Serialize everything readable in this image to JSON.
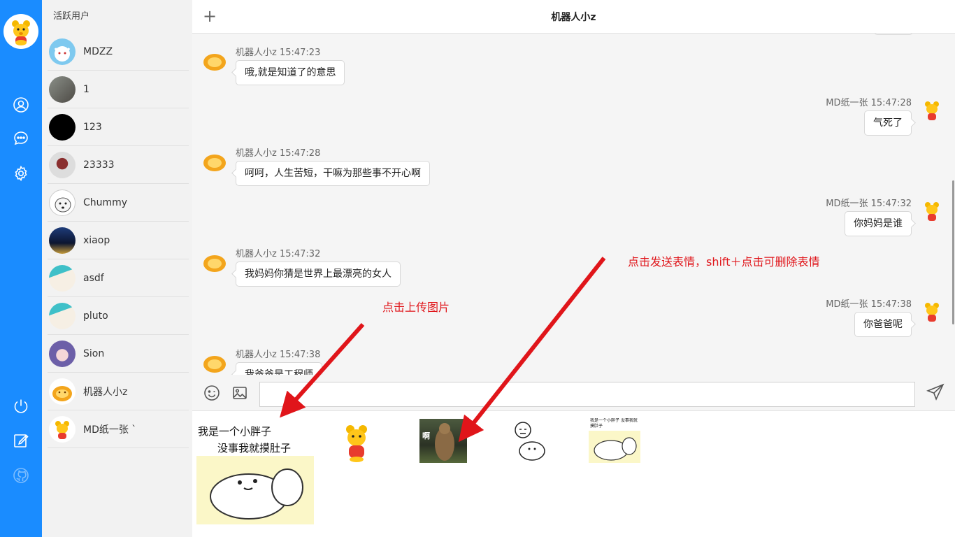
{
  "sidebar": {
    "title": "活跃用户"
  },
  "users": [
    {
      "name": "MDZZ"
    },
    {
      "name": "1"
    },
    {
      "name": "123"
    },
    {
      "name": "23333"
    },
    {
      "name": "Chummy"
    },
    {
      "name": "xiaop"
    },
    {
      "name": "asdf"
    },
    {
      "name": "pluto"
    },
    {
      "name": "Sion"
    },
    {
      "name": "机器人小z"
    },
    {
      "name": "MD纸一张 `"
    }
  ],
  "header": {
    "add_label": "+",
    "title": "机器人小z"
  },
  "messages": [
    {
      "side": "left",
      "meta": "机器人小z 15:47:23",
      "text": "哦,就是知道了的意思"
    },
    {
      "side": "right",
      "meta": "MD纸一张 15:47:28",
      "text": "气死了"
    },
    {
      "side": "left",
      "meta": "机器人小z 15:47:28",
      "text": "呵呵，人生苦短，干嘛为那些事不开心啊"
    },
    {
      "side": "right",
      "meta": "MD纸一张 15:47:32",
      "text": "你妈妈是谁"
    },
    {
      "side": "left",
      "meta": "机器人小z 15:47:32",
      "text": "我妈妈你猜是世界上最漂亮的女人"
    },
    {
      "side": "right",
      "meta": "MD纸一张 15:47:38",
      "text": "你爸爸呢"
    },
    {
      "side": "left",
      "meta": "机器人小z 15:47:38",
      "text": "我爸爸是工程师"
    }
  ],
  "composer": {
    "placeholder": "",
    "value": ""
  },
  "emoji": {
    "meme1_line1": "我是一个小胖子",
    "meme1_line2": "没事我就摸肚子",
    "meme2_label": "啊",
    "meme5_label": "我是一个小胖子 没事我就摸肚子"
  },
  "annotations": {
    "upload": "点击上传图片",
    "send_emoji": "点击发送表情，shift＋点击可删除表情"
  },
  "colors": {
    "nav_bg": "#1a8cff",
    "annotation": "#e0151a"
  }
}
